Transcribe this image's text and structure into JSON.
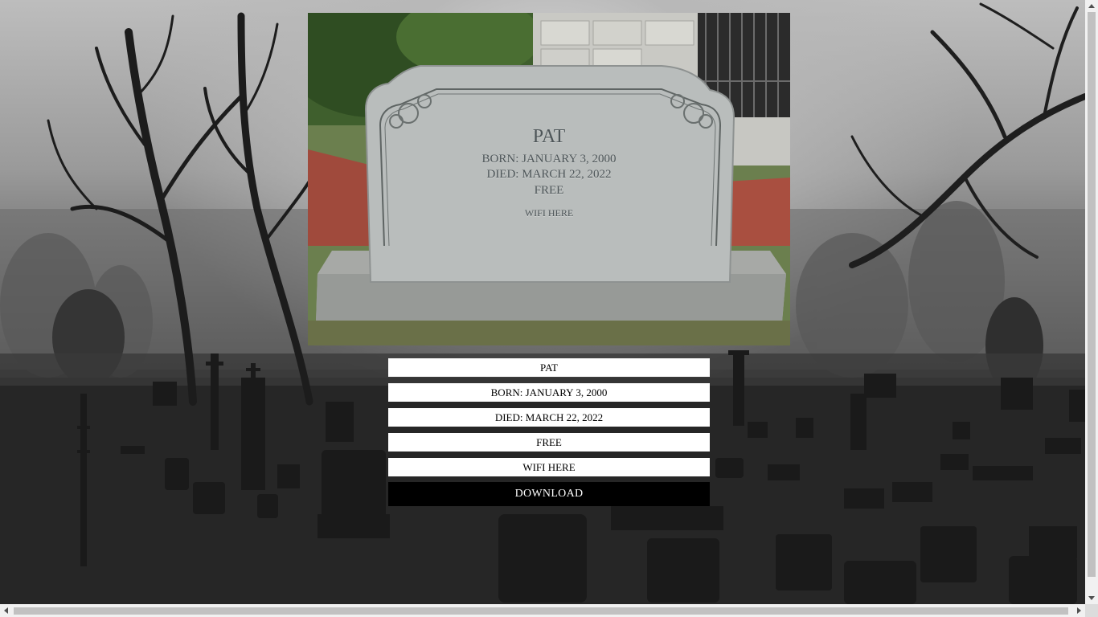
{
  "tombstone": {
    "name": "PAT",
    "born": "BORN: JANUARY 3, 2000",
    "died": "DIED: MARCH 22, 2022",
    "note": "FREE",
    "wifi": "WIFI HERE"
  },
  "form": {
    "name_value": "PAT",
    "born_value": "BORN: JANUARY 3, 2000",
    "died_value": "DIED: MARCH 22, 2022",
    "note_value": "FREE",
    "wifi_value": "WIFI HERE",
    "download_label": "DOWNLOAD"
  },
  "colors": {
    "download_bg": "#000000",
    "download_text": "#ffffff",
    "field_bg": "#ffffff",
    "engraving": "#4d5558"
  },
  "icons": [
    "scroll-up-arrow-icon",
    "scroll-down-arrow-icon",
    "scroll-left-arrow-icon",
    "scroll-right-arrow-icon"
  ]
}
